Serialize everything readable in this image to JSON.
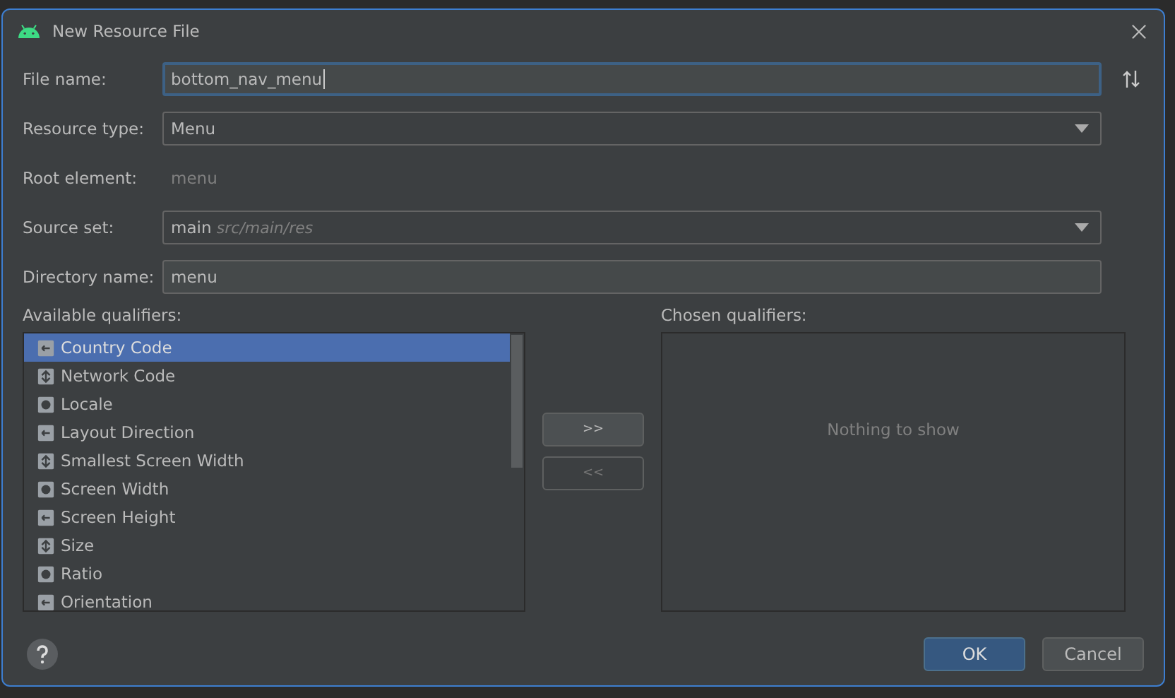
{
  "window": {
    "title": "New Resource File"
  },
  "file_name": {
    "label": "File name:",
    "value": "bottom_nav_menu"
  },
  "resource_type": {
    "label": "Resource type:",
    "value": "Menu"
  },
  "root_element": {
    "label": "Root element:",
    "value": "menu"
  },
  "source_set": {
    "label": "Source set:",
    "value": "main",
    "hint": "src/main/res"
  },
  "directory_name": {
    "label": "Directory name:",
    "value": "menu"
  },
  "available_qualifiers": {
    "label": "Available qualifiers:",
    "items": [
      {
        "label": "Country Code",
        "selected": true
      },
      {
        "label": "Network Code",
        "selected": false
      },
      {
        "label": "Locale",
        "selected": false
      },
      {
        "label": "Layout Direction",
        "selected": false
      },
      {
        "label": "Smallest Screen Width",
        "selected": false
      },
      {
        "label": "Screen Width",
        "selected": false
      },
      {
        "label": "Screen Height",
        "selected": false
      },
      {
        "label": "Size",
        "selected": false
      },
      {
        "label": "Ratio",
        "selected": false
      },
      {
        "label": "Orientation",
        "selected": false
      }
    ]
  },
  "move_buttons": [
    {
      "label": ">>",
      "disabled": false
    },
    {
      "label": "<<",
      "disabled": true
    }
  ],
  "chosen_qualifiers": {
    "label": "Chosen qualifiers:",
    "empty_text": "Nothing to show"
  },
  "buttons": [
    {
      "label": "OK",
      "kind": "primary"
    },
    {
      "label": "Cancel",
      "kind": "secondary"
    }
  ]
}
